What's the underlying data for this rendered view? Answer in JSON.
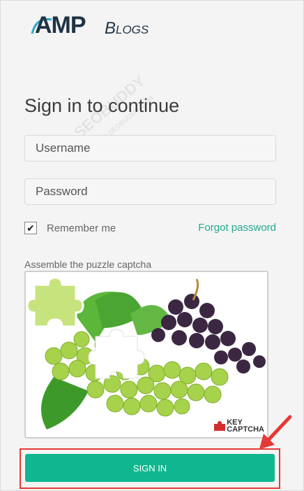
{
  "logo": {
    "main": "AMP",
    "secondary": "Blogs"
  },
  "heading": "Sign in to continue",
  "form": {
    "username_placeholder": "Username",
    "password_placeholder": "Password",
    "remember_label": "Remember me",
    "remember_checked": true,
    "forgot_label": "Forgot password",
    "captcha_label": "Assemble the puzzle captcha",
    "captcha_brand_line1": "KEY",
    "captcha_brand_line2": "CAPTCHA",
    "submit_label": "SIGN IN"
  },
  "watermark": {
    "main": "SEOBUDDY",
    "sub": "WWW.SEOBUDDY.COM"
  },
  "colors": {
    "accent": "#0fb68f",
    "link": "#23a98b",
    "highlight": "#e53935",
    "logo": "#1e3345"
  }
}
